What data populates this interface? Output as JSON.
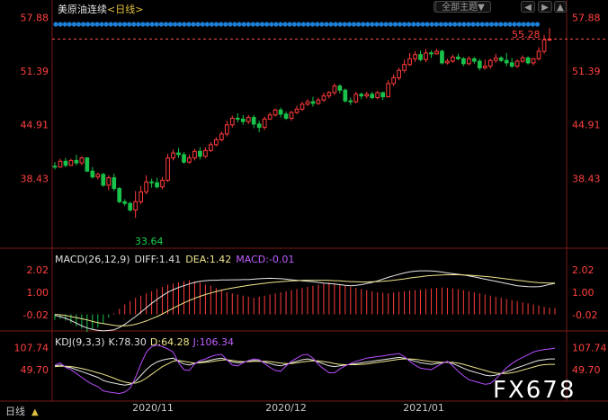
{
  "header": {
    "instrument": "美原油连续",
    "period_prefix": "<",
    "period": "日线",
    "period_suffix": ">",
    "theme_button": "全部主题",
    "theme_caret": "▼",
    "prev_button": "◀",
    "next_button": "▶",
    "collapse_button": "▲"
  },
  "colors": {
    "up": "#ff3b3b",
    "down": "#19c24a",
    "price_label": "#ff4040",
    "diff": "#e8e8e8",
    "dea": "#f0e68c",
    "j": "#b84dff",
    "dots": "#1e7fd6"
  },
  "main_panel": {
    "y_ticks": [
      "57.88",
      "51.39",
      "44.91",
      "38.43"
    ],
    "y_values": [
      57.88,
      51.39,
      44.91,
      38.43
    ],
    "last_price": "55.28",
    "low_label": "33.64"
  },
  "macd_panel": {
    "title": "MACD(26,12,9)",
    "diff_label": "DIFF:",
    "diff_value": "1.41",
    "dea_label": "DEA:",
    "dea_value": "1.42",
    "macd_label": "MACD:",
    "macd_value": "-0.01",
    "y_ticks": [
      "2.02",
      "1.00",
      "-0.02"
    ],
    "y_values": [
      2.02,
      1.0,
      -0.02
    ]
  },
  "kdj_panel": {
    "title": "KDJ(9,3,3)",
    "k_label": "K:",
    "k_value": "78.30",
    "d_label": "D:",
    "d_value": "64.28",
    "j_label": "J:",
    "j_value": "106.34",
    "y_ticks": [
      "107.74",
      "49.70"
    ],
    "y_values": [
      107.74,
      49.7
    ]
  },
  "x_axis": {
    "left_label": "日线",
    "ticks": [
      "2020/11",
      "2020/12",
      "2021/01"
    ]
  },
  "watermark": "FX678",
  "chart_data": {
    "type": "candlestick",
    "unit": "USD",
    "x_ticks": [
      "2020/11",
      "2020/12",
      "2021/01"
    ],
    "candles": [
      [
        39.9,
        39.8,
        40.4,
        39.5
      ],
      [
        39.8,
        40.5,
        40.8,
        39.7
      ],
      [
        40.5,
        40.0,
        40.9,
        39.8
      ],
      [
        40.0,
        40.6,
        40.8,
        39.9
      ],
      [
        40.6,
        40.3,
        41.3,
        40.0
      ],
      [
        40.3,
        40.9,
        41.1,
        40.0
      ],
      [
        40.9,
        39.3,
        41.0,
        39.2
      ],
      [
        39.3,
        38.6,
        39.8,
        38.4
      ],
      [
        38.6,
        38.9,
        39.1,
        38.3
      ],
      [
        38.9,
        37.6,
        39.1,
        37.4
      ],
      [
        37.6,
        38.5,
        38.8,
        37.0
      ],
      [
        38.5,
        37.2,
        39.0,
        36.9
      ],
      [
        37.2,
        35.6,
        37.4,
        35.4
      ],
      [
        35.6,
        35.4,
        35.9,
        35.1
      ],
      [
        35.4,
        34.6,
        35.6,
        34.4
      ],
      [
        34.6,
        35.6,
        36.9,
        33.64
      ],
      [
        35.6,
        36.8,
        37.5,
        35.3
      ],
      [
        36.8,
        38.0,
        38.8,
        36.5
      ],
      [
        38.0,
        37.9,
        38.4,
        37.3
      ],
      [
        37.9,
        37.4,
        38.5,
        37.2
      ],
      [
        37.4,
        38.2,
        38.6,
        37.1
      ],
      [
        38.2,
        40.9,
        41.4,
        38.0
      ],
      [
        40.9,
        41.5,
        41.9,
        40.6
      ],
      [
        41.5,
        41.3,
        42.1,
        40.9
      ],
      [
        41.3,
        40.4,
        41.6,
        40.2
      ],
      [
        40.4,
        40.9,
        41.3,
        40.2
      ],
      [
        40.9,
        41.7,
        42.0,
        40.6
      ],
      [
        41.7,
        41.1,
        42.2,
        40.7
      ],
      [
        41.1,
        41.8,
        42.2,
        40.9
      ],
      [
        41.8,
        42.5,
        42.8,
        41.6
      ],
      [
        42.5,
        43.1,
        43.4,
        42.3
      ],
      [
        43.1,
        43.8,
        44.1,
        42.9
      ],
      [
        43.8,
        44.9,
        45.4,
        43.5
      ],
      [
        44.9,
        45.7,
        46.0,
        44.6
      ],
      [
        45.7,
        45.6,
        46.3,
        45.2
      ],
      [
        45.6,
        45.3,
        46.1,
        44.9
      ],
      [
        45.3,
        45.8,
        46.1,
        45.0
      ],
      [
        45.8,
        45.0,
        46.1,
        44.5
      ],
      [
        45.0,
        44.6,
        45.4,
        44.0
      ],
      [
        44.6,
        45.6,
        45.9,
        44.3
      ],
      [
        45.6,
        46.1,
        46.4,
        45.5
      ],
      [
        46.1,
        46.7,
        46.9,
        45.9
      ],
      [
        46.7,
        46.2,
        47.0,
        45.8
      ],
      [
        46.2,
        45.7,
        46.5,
        45.5
      ],
      [
        45.7,
        46.4,
        46.6,
        45.4
      ],
      [
        46.4,
        46.8,
        47.2,
        46.2
      ],
      [
        46.8,
        47.4,
        47.7,
        46.6
      ],
      [
        47.4,
        47.7,
        48.0,
        47.2
      ],
      [
        47.7,
        47.5,
        48.3,
        47.1
      ],
      [
        47.5,
        47.9,
        48.2,
        47.3
      ],
      [
        47.9,
        48.4,
        48.8,
        47.7
      ],
      [
        48.4,
        48.8,
        49.0,
        48.1
      ],
      [
        48.8,
        49.6,
        49.9,
        48.5
      ],
      [
        49.6,
        49.1,
        49.8,
        48.7
      ],
      [
        49.1,
        47.8,
        49.3,
        47.6
      ],
      [
        47.8,
        47.7,
        48.2,
        47.3
      ],
      [
        47.7,
        48.6,
        48.9,
        47.5
      ],
      [
        48.6,
        48.4,
        48.8,
        48.0
      ],
      [
        48.4,
        48.6,
        48.9,
        48.1
      ],
      [
        48.6,
        48.2,
        48.9,
        48.0
      ],
      [
        48.2,
        48.8,
        49.0,
        48.0
      ],
      [
        48.8,
        48.3,
        48.9,
        47.9
      ],
      [
        48.3,
        49.9,
        50.3,
        48.2
      ],
      [
        49.9,
        50.6,
        51.0,
        49.6
      ],
      [
        50.6,
        51.5,
        51.8,
        50.3
      ],
      [
        51.5,
        52.2,
        52.8,
        51.2
      ],
      [
        52.2,
        52.9,
        53.6,
        52.0
      ],
      [
        52.9,
        53.4,
        53.8,
        52.5
      ],
      [
        53.4,
        52.8,
        53.9,
        52.6
      ],
      [
        52.8,
        53.6,
        54.1,
        52.5
      ],
      [
        53.6,
        53.5,
        53.9,
        53.0
      ],
      [
        53.5,
        53.8,
        54.1,
        53.4
      ],
      [
        53.8,
        52.4,
        54.0,
        52.2
      ],
      [
        52.4,
        52.6,
        52.9,
        52.2
      ],
      [
        52.6,
        53.1,
        53.4,
        52.4
      ],
      [
        53.1,
        52.9,
        53.5,
        52.7
      ],
      [
        52.9,
        52.3,
        53.1,
        52.0
      ],
      [
        52.3,
        52.9,
        53.2,
        52.1
      ],
      [
        52.9,
        52.6,
        53.1,
        52.3
      ],
      [
        52.6,
        51.8,
        52.9,
        51.5
      ],
      [
        51.8,
        52.0,
        52.8,
        51.6
      ],
      [
        52.0,
        52.7,
        52.9,
        51.7
      ],
      [
        52.7,
        53.0,
        53.5,
        52.4
      ],
      [
        53.0,
        52.7,
        53.2,
        52.5
      ],
      [
        52.7,
        52.4,
        53.6,
        52.0
      ],
      [
        52.4,
        52.0,
        53.0,
        51.8
      ],
      [
        52.0,
        52.6,
        52.8,
        51.8
      ],
      [
        52.6,
        53.0,
        53.3,
        52.4
      ],
      [
        53.0,
        52.4,
        53.2,
        52.2
      ],
      [
        52.4,
        52.9,
        53.0,
        52.1
      ],
      [
        52.9,
        53.8,
        54.3,
        52.7
      ],
      [
        53.8,
        55.2,
        55.8,
        53.5
      ],
      [
        55.2,
        55.28,
        56.6,
        55.0
      ]
    ],
    "macd": [
      -0.25,
      -0.2,
      -0.28,
      -0.4,
      -0.55,
      -0.65,
      -0.8,
      -0.7,
      -0.6,
      -0.4,
      -0.15,
      0.05,
      0.25,
      0.45,
      0.6,
      0.75,
      0.85,
      0.95,
      1.05,
      1.15,
      1.25,
      1.35,
      1.4,
      1.45,
      1.5,
      1.55,
      1.5,
      1.45,
      1.35,
      1.3,
      1.2,
      1.1,
      1.0,
      0.95,
      0.9,
      0.85,
      0.8,
      0.75,
      0.8,
      0.85,
      0.9,
      0.95,
      1.0,
      1.05,
      1.1,
      1.15,
      1.2,
      1.25,
      1.3,
      1.35,
      1.4,
      1.45,
      1.4,
      1.35,
      1.3,
      1.25,
      1.2,
      1.15,
      1.1,
      1.05,
      1.0,
      0.98,
      0.96,
      0.99,
      1.02,
      1.05,
      1.08,
      1.1,
      1.12,
      1.15,
      1.18,
      1.2,
      1.22,
      1.2,
      1.18,
      1.15,
      1.1,
      1.05,
      1.0,
      0.95,
      0.9,
      0.85,
      0.8,
      0.75,
      0.7,
      0.65,
      0.6,
      0.55,
      0.5,
      0.45,
      0.4,
      0.35,
      0.3,
      0.28
    ],
    "diff": [
      -0.05,
      -0.1,
      -0.18,
      -0.28,
      -0.4,
      -0.52,
      -0.62,
      -0.68,
      -0.72,
      -0.75,
      -0.73,
      -0.7,
      -0.6,
      -0.45,
      -0.28,
      -0.1,
      0.1,
      0.3,
      0.5,
      0.68,
      0.85,
      1.0,
      1.12,
      1.22,
      1.3,
      1.38,
      1.45,
      1.5,
      1.53,
      1.55,
      1.55,
      1.56,
      1.56,
      1.57,
      1.57,
      1.58,
      1.58,
      1.6,
      1.62,
      1.63,
      1.64,
      1.63,
      1.62,
      1.6,
      1.57,
      1.55,
      1.52,
      1.5,
      1.48,
      1.45,
      1.42,
      1.4,
      1.38,
      1.35,
      1.32,
      1.3,
      1.32,
      1.35,
      1.4,
      1.45,
      1.52,
      1.6,
      1.68,
      1.75,
      1.82,
      1.88,
      1.93,
      1.96,
      1.98,
      1.98,
      1.97,
      1.95,
      1.92,
      1.88,
      1.85,
      1.82,
      1.79,
      1.75,
      1.7,
      1.65,
      1.6,
      1.55,
      1.5,
      1.45,
      1.4,
      1.35,
      1.3,
      1.28,
      1.26,
      1.25,
      1.26,
      1.3,
      1.36,
      1.41
    ],
    "dea": [
      0.0,
      -0.02,
      -0.05,
      -0.1,
      -0.15,
      -0.2,
      -0.25,
      -0.32,
      -0.38,
      -0.42,
      -0.46,
      -0.5,
      -0.52,
      -0.52,
      -0.5,
      -0.45,
      -0.38,
      -0.3,
      -0.2,
      -0.1,
      0.02,
      0.15,
      0.28,
      0.4,
      0.52,
      0.63,
      0.73,
      0.82,
      0.9,
      0.97,
      1.04,
      1.1,
      1.15,
      1.2,
      1.24,
      1.28,
      1.32,
      1.35,
      1.38,
      1.41,
      1.44,
      1.46,
      1.48,
      1.5,
      1.52,
      1.53,
      1.54,
      1.55,
      1.55,
      1.55,
      1.55,
      1.54,
      1.53,
      1.52,
      1.5,
      1.49,
      1.48,
      1.47,
      1.47,
      1.48,
      1.49,
      1.5,
      1.52,
      1.55,
      1.58,
      1.61,
      1.65,
      1.68,
      1.71,
      1.74,
      1.76,
      1.78,
      1.79,
      1.8,
      1.8,
      1.8,
      1.79,
      1.78,
      1.76,
      1.74,
      1.72,
      1.7,
      1.67,
      1.64,
      1.61,
      1.58,
      1.55,
      1.52,
      1.49,
      1.46,
      1.44,
      1.43,
      1.42,
      1.42
    ],
    "k": [
      60,
      62,
      58,
      55,
      50,
      45,
      40,
      35,
      30,
      22,
      18,
      15,
      12,
      10,
      12,
      20,
      35,
      50,
      62,
      70,
      75,
      78,
      80,
      72,
      65,
      62,
      66,
      70,
      72,
      75,
      78,
      80,
      76,
      70,
      68,
      70,
      72,
      74,
      73,
      70,
      66,
      62,
      60,
      64,
      68,
      72,
      76,
      78,
      75,
      70,
      65,
      60,
      58,
      60,
      62,
      64,
      66,
      68,
      70,
      72,
      74,
      76,
      78,
      80,
      82,
      80,
      76,
      72,
      68,
      66,
      64,
      66,
      68,
      70,
      66,
      60,
      54,
      48,
      44,
      40,
      36,
      34,
      36,
      40,
      45,
      50,
      55,
      60,
      65,
      70,
      74,
      76,
      78,
      78
    ],
    "d": [
      58,
      59,
      59,
      58,
      56,
      53,
      50,
      46,
      42,
      38,
      33,
      28,
      22,
      18,
      15,
      15,
      20,
      28,
      38,
      48,
      58,
      65,
      72,
      74,
      72,
      69,
      67,
      68,
      69,
      71,
      73,
      75,
      76,
      74,
      72,
      71,
      71,
      72,
      72,
      72,
      71,
      69,
      67,
      66,
      66,
      68,
      70,
      72,
      73,
      73,
      71,
      69,
      66,
      64,
      63,
      63,
      63,
      64,
      65,
      67,
      69,
      71,
      73,
      75,
      77,
      78,
      78,
      77,
      75,
      73,
      71,
      70,
      69,
      69,
      69,
      67,
      64,
      60,
      56,
      52,
      48,
      44,
      41,
      40,
      40,
      42,
      45,
      49,
      53,
      57,
      61,
      63,
      64,
      64
    ],
    "j": [
      62,
      68,
      56,
      50,
      40,
      30,
      20,
      12,
      6,
      -5,
      -8,
      -10,
      -12,
      -8,
      2,
      30,
      65,
      95,
      110,
      114,
      110,
      104,
      96,
      68,
      50,
      48,
      65,
      74,
      78,
      84,
      88,
      90,
      76,
      62,
      60,
      68,
      74,
      78,
      76,
      66,
      56,
      48,
      46,
      60,
      72,
      80,
      88,
      90,
      80,
      64,
      52,
      42,
      42,
      52,
      60,
      66,
      72,
      76,
      80,
      82,
      84,
      86,
      88,
      90,
      92,
      84,
      72,
      62,
      54,
      52,
      50,
      58,
      66,
      72,
      60,
      46,
      34,
      24,
      20,
      16,
      12,
      14,
      26,
      40,
      55,
      66,
      75,
      82,
      89,
      96,
      100,
      102,
      104,
      106
    ]
  }
}
